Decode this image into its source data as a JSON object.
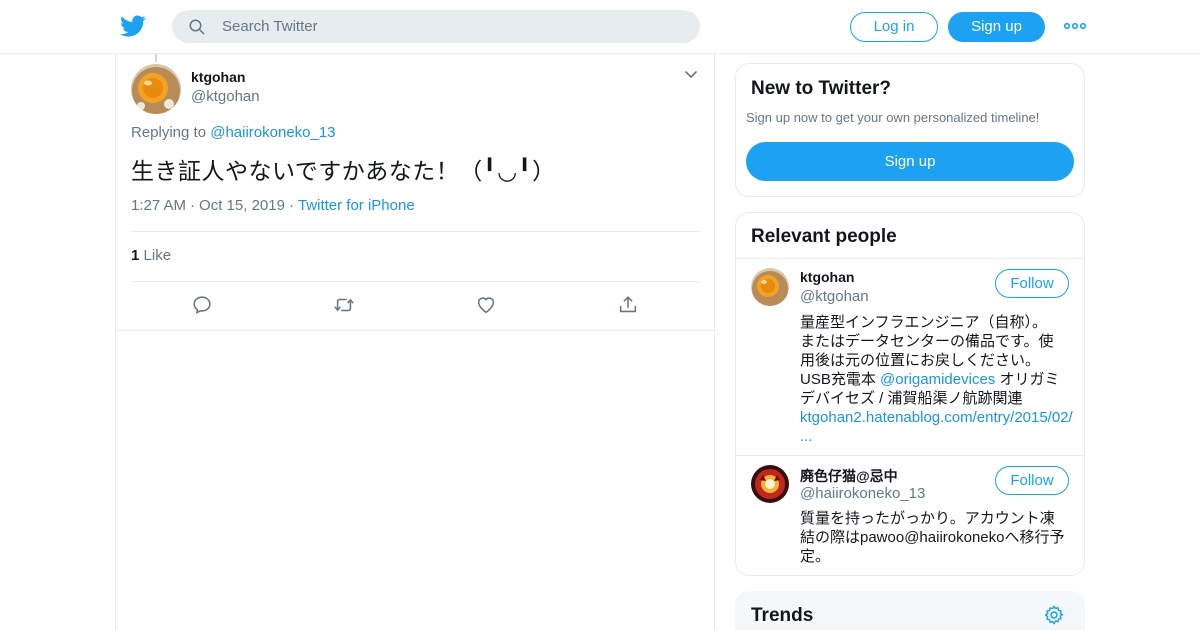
{
  "header": {
    "search_placeholder": "Search Twitter",
    "login_label": "Log in",
    "signup_label": "Sign up"
  },
  "tweet": {
    "author_name": "ktgohan",
    "author_handle": "@ktgohan",
    "replying_prefix": "Replying to",
    "replying_handle": "@haiirokoneko_13",
    "text": "生き証人やないですかあなた！（╹◡╹）",
    "time": "1:27 AM",
    "date": "Oct 15, 2019",
    "source": "Twitter for iPhone",
    "like_count": "1",
    "like_label": "Like"
  },
  "sidebar": {
    "new_title": "New to Twitter?",
    "new_subtitle": "Sign up now to get your own personalized timeline!",
    "new_signup_label": "Sign up",
    "relevant_title": "Relevant people",
    "people": [
      {
        "name": "ktgohan",
        "handle": "@ktgohan",
        "follow_label": "Follow",
        "bio_lines": [
          "量産型インフラエンジニア（自称）。",
          "またはデータセンターの備品です。使",
          "用後は元の位置にお戻しください。",
          "USB充電本 ",
          "@origamidevices",
          " オリガミ",
          "デバイセズ / 浦賀船渠ノ航跡関連",
          "ktgohan2.hatenablog.com/entry/2015/02/",
          "..."
        ]
      },
      {
        "name": "廃色仔猫@忌中",
        "handle": "@haiirokoneko_13",
        "follow_label": "Follow",
        "bio_lines": [
          "質量を持ったがっかり。アカウント凍",
          "結の際はpawoo@haiirokonekoへ移行予",
          "定。"
        ]
      }
    ],
    "trends_title": "Trends"
  },
  "colors": {
    "accent": "#1da1f2",
    "link": "#1b95e0",
    "secondary_text": "#657786",
    "border": "#e6ecf0"
  },
  "icons": [
    "twitter-bird-icon",
    "search-icon",
    "more-dots-icon",
    "chevron-down-icon",
    "reply-icon",
    "retweet-icon",
    "like-icon",
    "share-icon",
    "settings-gear-icon"
  ]
}
